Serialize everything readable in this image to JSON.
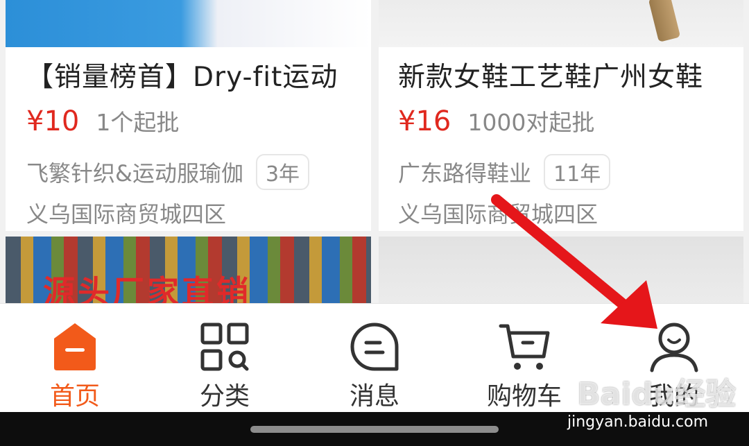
{
  "products": [
    {
      "title": "【销量榜首】Dry-fit运动",
      "price": "¥10",
      "moq": "1个起批",
      "shop": "飞繁针织&运动服瑜伽",
      "years": "3年",
      "location": "义乌国际商贸城四区"
    },
    {
      "title": "新款女鞋工艺鞋广州女鞋",
      "price": "¥16",
      "moq": "1000对起批",
      "shop": "广东路得鞋业",
      "years": "11年",
      "location": "义乌国际商贸城四区"
    }
  ],
  "promo_text": "源头厂家直销",
  "tabs": [
    {
      "label": "首页",
      "icon": "home-icon",
      "active": true
    },
    {
      "label": "分类",
      "icon": "category-grid-icon",
      "active": false
    },
    {
      "label": "消息",
      "icon": "message-bubble-icon",
      "active": false
    },
    {
      "label": "购物车",
      "icon": "shopping-cart-icon",
      "active": false
    },
    {
      "label": "我的",
      "icon": "profile-icon",
      "active": false
    }
  ],
  "watermark": {
    "logo": "Baidu经验",
    "url": "jingyan.baidu.com"
  },
  "colors": {
    "accent": "#f25a1a",
    "price": "#e0281e",
    "arrow": "#e5161a"
  }
}
